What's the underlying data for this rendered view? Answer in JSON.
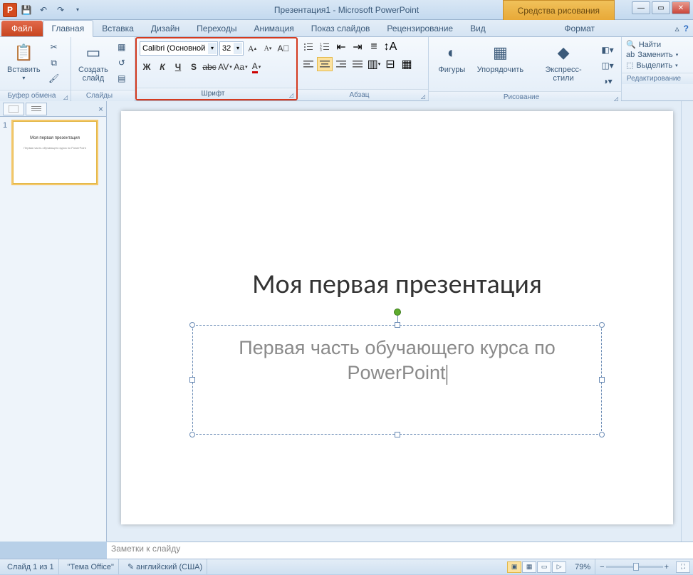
{
  "app": {
    "title": "Презентация1 - Microsoft PowerPoint",
    "icon": "P"
  },
  "context_tab": {
    "group": "Средства рисования",
    "tab": "Формат"
  },
  "tabs": {
    "file": "Файл",
    "items": [
      "Главная",
      "Вставка",
      "Дизайн",
      "Переходы",
      "Анимация",
      "Показ слайдов",
      "Рецензирование",
      "Вид"
    ],
    "active": "Главная"
  },
  "ribbon": {
    "clipboard": {
      "label": "Буфер обмена",
      "paste": "Вставить"
    },
    "slides": {
      "label": "Слайды",
      "new_slide": "Создать\nслайд"
    },
    "font": {
      "label": "Шрифт",
      "name": "Calibri (Основной",
      "size": "32"
    },
    "paragraph": {
      "label": "Абзац"
    },
    "drawing": {
      "label": "Рисование",
      "shapes": "Фигуры",
      "arrange": "Упорядочить",
      "quick_styles": "Экспресс-стили"
    },
    "editing": {
      "label": "Редактирование",
      "find": "Найти",
      "replace": "Заменить",
      "select": "Выделить"
    }
  },
  "slide": {
    "title": "Моя первая презентация",
    "subtitle": "Первая часть обучающего курса по PowerPoint"
  },
  "thumb": {
    "number": "1",
    "title": "Моя первая презентация",
    "sub": "Первая часть обучающего курса по PowerPoint"
  },
  "notes": {
    "placeholder": "Заметки к слайду"
  },
  "status": {
    "slide_info": "Слайд 1 из 1",
    "theme": "\"Тема Office\"",
    "language": "английский (США)",
    "zoom": "79%"
  }
}
